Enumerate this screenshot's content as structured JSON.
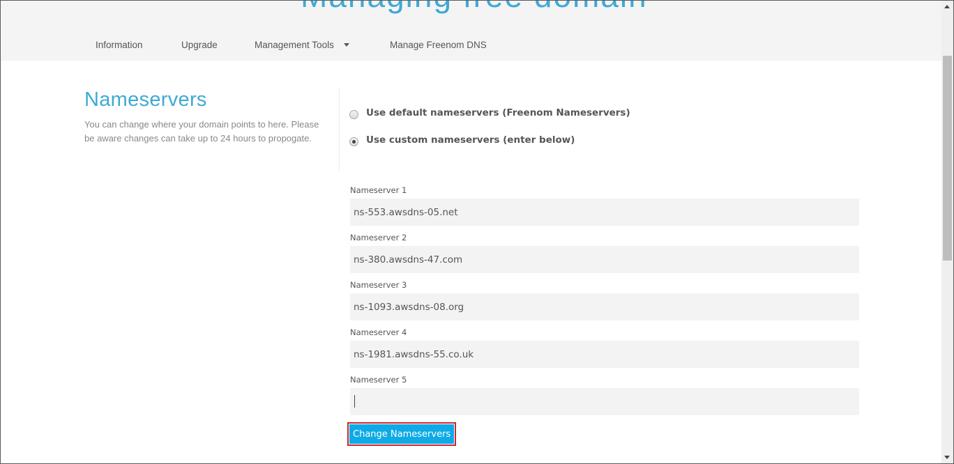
{
  "header": {
    "title_partial": "Managing free domain"
  },
  "nav": {
    "items": [
      {
        "label": "Information",
        "has_dropdown": false
      },
      {
        "label": "Upgrade",
        "has_dropdown": false
      },
      {
        "label": "Management Tools",
        "has_dropdown": true,
        "icon": "caret-down-icon"
      },
      {
        "label": "Manage Freenom DNS",
        "has_dropdown": false
      }
    ]
  },
  "nameservers": {
    "title": "Nameservers",
    "description": "You can change where your domain points to here. Please be aware changes can take up to 24 hours to propogate.",
    "options": [
      {
        "label": "Use default nameservers (Freenom Nameservers)",
        "checked": false
      },
      {
        "label": "Use custom nameservers (enter below)",
        "checked": true
      }
    ],
    "fields": [
      {
        "label": "Nameserver 1",
        "value": "ns-553.awsdns-05.net"
      },
      {
        "label": "Nameserver 2",
        "value": "ns-380.awsdns-47.com"
      },
      {
        "label": "Nameserver 3",
        "value": "ns-1093.awsdns-08.org"
      },
      {
        "label": "Nameserver 4",
        "value": "ns-1981.awsdns-55.co.uk"
      },
      {
        "label": "Nameserver 5",
        "value": ""
      }
    ],
    "submit_label": "Change Nameservers"
  },
  "colors": {
    "accent": "#3fa9d4",
    "button": "#0eaae6",
    "highlight_border": "#c8272f"
  },
  "scrollbar": {
    "position_fraction": 0.0
  }
}
